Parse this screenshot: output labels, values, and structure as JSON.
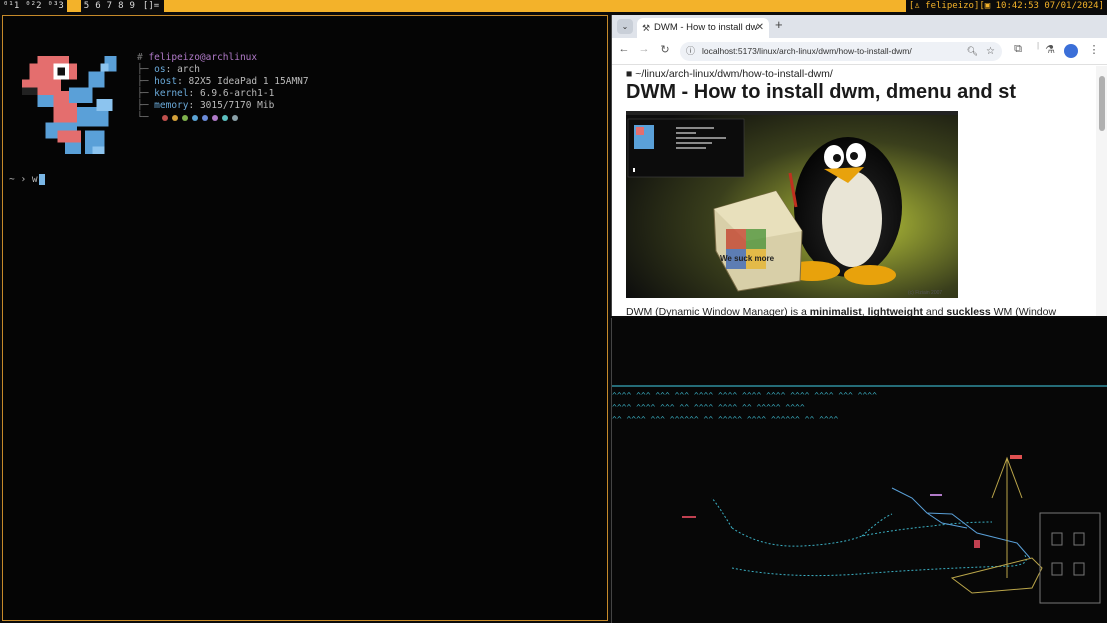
{
  "bar": {
    "tags": [
      {
        "label": "⁰¹1",
        "state": "occ"
      },
      {
        "label": "⁰²2",
        "state": "occ"
      },
      {
        "label": "⁰³3",
        "state": "occ"
      },
      {
        "label": "",
        "state": "sel"
      },
      {
        "label": "5",
        "state": "empty"
      },
      {
        "label": "6",
        "state": "empty"
      },
      {
        "label": "7",
        "state": "empty"
      },
      {
        "label": "8",
        "state": "empty"
      },
      {
        "label": "9",
        "state": "empty"
      }
    ],
    "layout": "[]=",
    "status": "[♙ felipeizo][▣ 10:42:53 07/01/2024]",
    "accent": "#f3b22a"
  },
  "terminal_left": {
    "user_host": "felipeizo@archlinux",
    "fetch": [
      {
        "key": "os",
        "value": "arch"
      },
      {
        "key": "host",
        "value": "82X5 IdeaPad 1 15AMN7"
      },
      {
        "key": "kernel",
        "value": "6.9.6-arch1-1"
      },
      {
        "key": "memory",
        "value": "3015/7170 Mib"
      }
    ],
    "dot_colors": [
      "#c0504d",
      "#d4a13a",
      "#7fb24d",
      "#5ba3d4",
      "#6a8bd8",
      "#b07ac8",
      "#5cc0c0",
      "#8aa0a8"
    ],
    "prompt": "~ › ",
    "typed": "w"
  },
  "browser": {
    "tab_title": "DWM - How to install dw",
    "url": "localhost:5173/linux/arch-linux/dwm/how-to-install-dwm/",
    "breadcrumb": "~/linux/arch-linux/dwm/how-to-install-dwm/",
    "heading": "DWM - How to install dwm, dmenu and st",
    "paragraph_start": "DWM (Dynamic Window Manager) is a ",
    "paragraph_b1": "minimalist",
    "paragraph_sep": ", ",
    "paragraph_b2": "lightweight",
    "paragraph_mid": " and ",
    "paragraph_b3": "suckless",
    "paragraph_end": " WM (Window",
    "image_caption": "We suck more",
    "image_credit": "(c) Fiziain 2007"
  },
  "icons": {
    "tab_menu": "chevron-down-icon",
    "favicon": "dwm-favicon-icon",
    "tab_close": "close-icon",
    "new_tab": "plus-icon",
    "back": "arrow-left-icon",
    "forward": "arrow-right-icon",
    "reload": "reload-icon",
    "site_info": "site-info-icon",
    "zoom": "zoom-icon",
    "bookmark": "star-icon",
    "extensions": "puzzle-icon",
    "labs": "flask-icon",
    "profile": "avatar-icon",
    "menu": "kebab-menu-icon",
    "folder": "folder-icon"
  }
}
